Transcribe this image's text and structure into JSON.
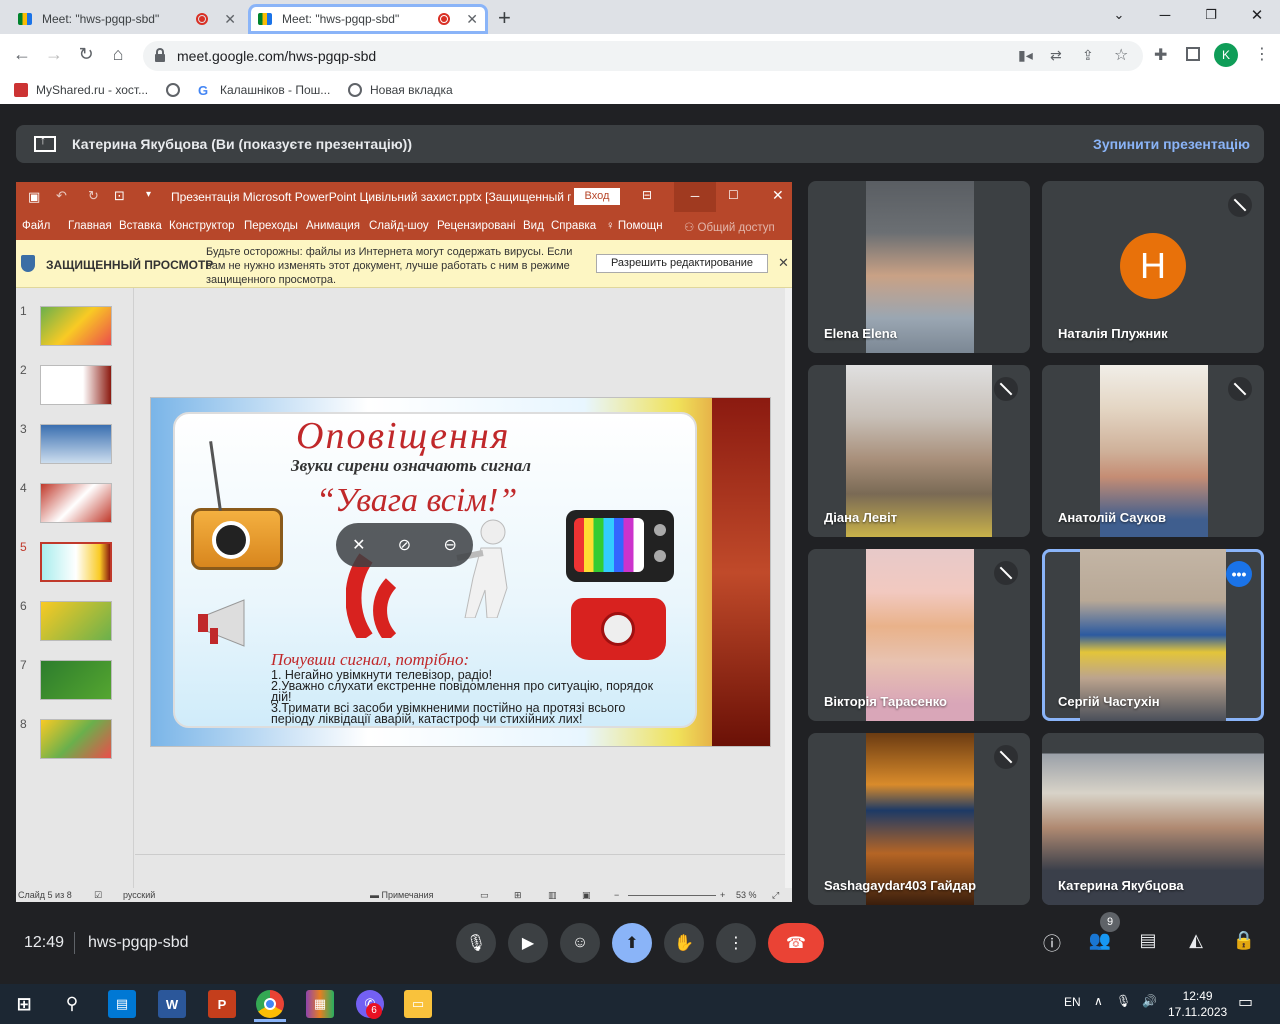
{
  "browser": {
    "tabs": [
      {
        "title": "Meet: \"hws-pgqp-sbd\""
      },
      {
        "title": "Meet: \"hws-pgqp-sbd\""
      }
    ],
    "url": "meet.google.com/hws-pgqp-sbd",
    "profile_initial": "K",
    "bookmarks": [
      "MyShared.ru - хост...",
      "Калашніков - Пош...",
      "Новая вкладка"
    ]
  },
  "presenting_bar": {
    "text": "Катерина Якубцова (Ви (показуєте презентацію))",
    "stop_label": "Зупинити презентацію"
  },
  "powerpoint": {
    "title": "Презентація Microsoft PowerPoint Цивільний захист.pptx [Защищенный п...",
    "login": "Вход",
    "ribbon": [
      "Файл",
      "Главная",
      "Вставка",
      "Конструктор",
      "Переходы",
      "Анимация",
      "Слайд-шоу",
      "Рецензировані",
      "Вид",
      "Справка",
      "Помощн",
      "Общий доступ"
    ],
    "warning_title": "ЗАЩИЩЕННЫЙ ПРОСМОТР",
    "warning_text": "Будьте осторожны: файлы из Интернета могут содержать вирусы. Если вам не нужно изменять этот документ, лучше работать с ним в режиме защищенного просмотра.",
    "enable_editing": "Разрешить редактирование",
    "slide_numbers": [
      "1",
      "2",
      "3",
      "4",
      "5",
      "6",
      "7",
      "8"
    ],
    "selected_slide": 5,
    "status_slide": "Слайд 5 из 8",
    "status_lang": "русский",
    "status_notes": "Примечания",
    "zoom": "53 %"
  },
  "slide": {
    "title": "Оповіщення",
    "subtitle": "Звуки сирени означають сигнал",
    "quote": "“Увага всім!”",
    "heading": "Почувши сигнал, потрібно:",
    "items": [
      "1. Негайно увімкнути телевізор, радіо!",
      "2.Уважно слухати екстренне повідомлення про ситуацію, порядок дій!",
      "3.Тримати всі засоби увімкненими постійно на протязі всього періоду ліквідації аварій, катастроф чи стихійних лих!"
    ]
  },
  "participants": [
    {
      "name": "Elena Elena",
      "muted": false
    },
    {
      "name": "Наталія Плужник",
      "muted": true,
      "initial": "Н",
      "color": "#e8710a"
    },
    {
      "name": "Діана Левіт",
      "muted": true
    },
    {
      "name": "Анатолій Сауков",
      "muted": true
    },
    {
      "name": "Вікторія Тарасенко",
      "muted": true
    },
    {
      "name": "Сергій Частухін",
      "muted": false
    },
    {
      "name": "Sashagaydar403 Гайдар",
      "muted": true
    },
    {
      "name": "Катерина Якубцова",
      "muted": false
    }
  ],
  "controls": {
    "time": "12:49",
    "meeting_code": "hws-pgqp-sbd",
    "people_count": "9"
  },
  "taskbar": {
    "lang": "EN",
    "time": "12:49",
    "date": "17.11.2023",
    "viber_badge": "6"
  }
}
